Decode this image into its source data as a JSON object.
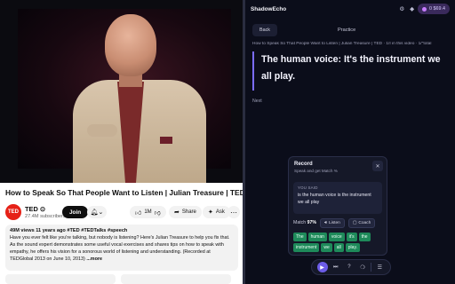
{
  "youtube": {
    "title": "How to Speak So That People Want to Listen | Julian Treasure | TED",
    "channel": {
      "logo_text": "TED",
      "name": "TED ⊙",
      "subs": "27.4M subscribers"
    },
    "join_label": "Join",
    "bell_icon": "bell-icon",
    "like_count": "1M",
    "share_label": "Share",
    "ask_label": "Ask",
    "more_icon": "ellipsis-icon",
    "description": {
      "meta": "49M views  11 years ago  #TED #TEDTalks #speech",
      "text": "Have you ever felt like you're talking, but nobody is listening? Here's Julian Treasure to help you fix that. As the sound expert demonstrates some useful vocal exercises and shares tips on how to speak with empathy, he offers his vision for a sonorous world of listening and understanding. (Recorded at TEDGlobal 2013 on June 10, 2013)",
      "more_label": "...more"
    }
  },
  "shadowecho": {
    "brand": "ShadowEcho",
    "credits": "0 $69.4",
    "back_label": "Back",
    "mode_label": "Practice",
    "source": "How to Speak So That People Want to Listen | Julian Treasure | TED  ·  1/I in this video  ·  1/\"total",
    "sentence": "The human voice: It's the instrument we all play.",
    "next_label": "Next",
    "record": {
      "title": "Record",
      "subtitle": "Speak and get Match %",
      "close_icon": "close-icon",
      "said_label": "YOU SAID",
      "said_text": "is the human voice is the instrument we all play",
      "match_prefix": "Match",
      "match_value": "97%",
      "listen_label": "Listen",
      "coach_label": "Coach",
      "chips": [
        "The",
        "human",
        "voice",
        "it's",
        "the",
        "instrument",
        "we",
        "all",
        "play."
      ]
    },
    "toolbar": {
      "mic_icon": "mic-icon",
      "skip_icon": "skip-icon",
      "help_icon": "help-icon",
      "bulb_icon": "bulb-icon",
      "menu_icon": "menu-icon"
    }
  }
}
